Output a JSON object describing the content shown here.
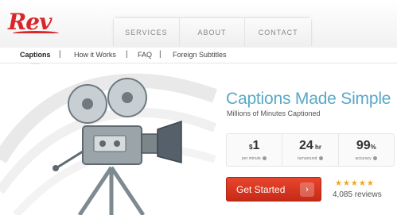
{
  "brand": {
    "logo_text": "Rev",
    "color": "#d9262b"
  },
  "topnav": {
    "items": [
      "SERVICES",
      "ABOUT",
      "CONTACT"
    ]
  },
  "subnav": {
    "items": [
      "Captions",
      "How it Works",
      "FAQ",
      "Foreign Subtitles"
    ],
    "active": "Captions",
    "separator": "|"
  },
  "hero": {
    "headline": "Captions Made Simple",
    "subline": "Millions of Minutes Captioned",
    "headline_color": "#59a8c6",
    "stats": [
      {
        "prefix": "$",
        "value": "1",
        "suffix": "",
        "label": "per minute"
      },
      {
        "prefix": "",
        "value": "24",
        "suffix": " hr",
        "label": "turnaround"
      },
      {
        "prefix": "",
        "value": "99",
        "suffix": "%",
        "label": "accuracy"
      }
    ],
    "cta_label": "Get Started",
    "cta_arrow": "›",
    "cta_color": "#d9372a",
    "rating_stars": "★★★★★",
    "rating_value": 5,
    "reviews_text": "4,085 reviews"
  }
}
